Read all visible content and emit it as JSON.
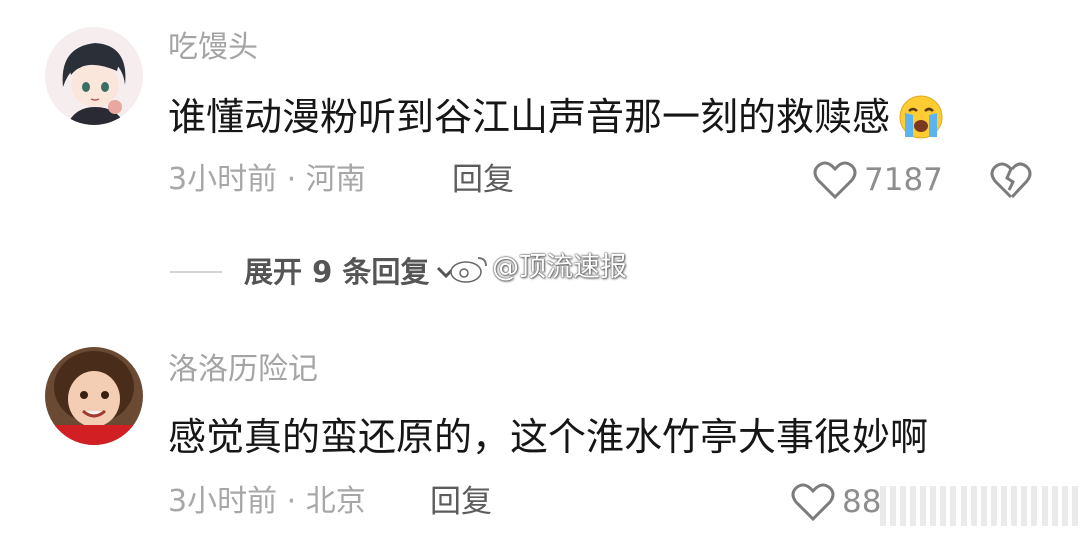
{
  "comments": [
    {
      "username": "吃馒头",
      "content": "谁懂动漫粉听到谷江山声音那一刻的救赎感",
      "emoji": "crying-face-icon",
      "meta": "3小时前 · 河南",
      "reply_label": "回复",
      "like_count": "7187"
    },
    {
      "username": "洛洛历险记",
      "content": "感觉真的蛮还原的，这个淮水竹亭大事很妙啊",
      "meta": "3小时前 · 北京",
      "reply_label": "回复",
      "like_count": "88"
    }
  ],
  "expand_replies": "展开 9 条回复",
  "watermark": "@顶流速报",
  "colors": {
    "text": "#161616",
    "muted": "#a7a7a7",
    "background": "#ffffff"
  }
}
